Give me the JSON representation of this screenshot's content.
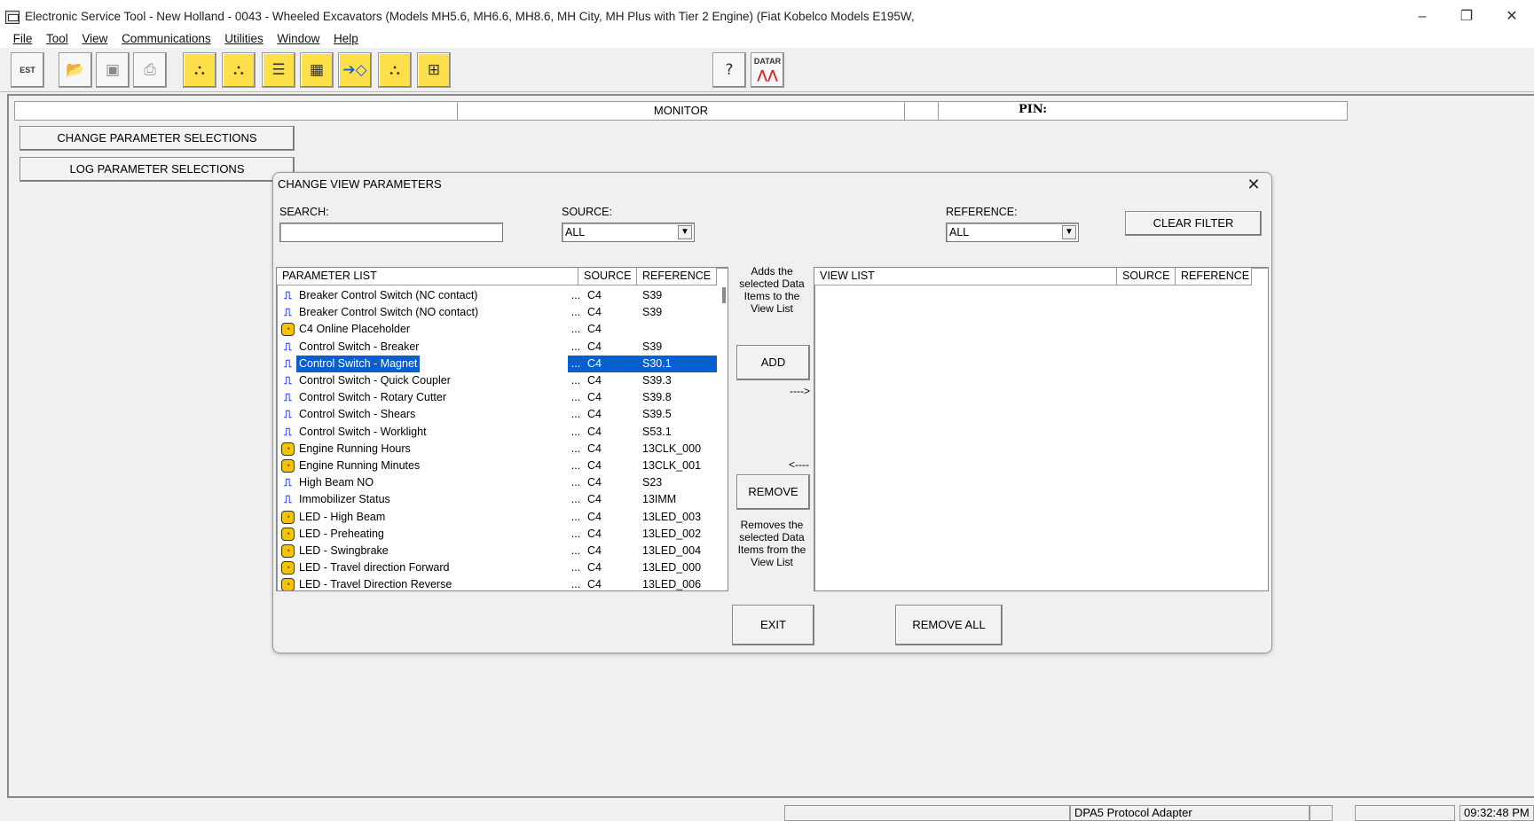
{
  "window": {
    "title": "Electronic Service Tool - New Holland - 0043 - Wheeled Excavators (Models MH5.6, MH6.6, MH8.6, MH City, MH Plus with Tier 2 Engine) (Fiat Kobelco Models E195W,",
    "minimize_glyph": "–",
    "maximize_glyph": "❐",
    "close_glyph": "✕"
  },
  "menu": [
    "File",
    "Tool",
    "View",
    "Communications",
    "Utilities",
    "Window",
    "Help"
  ],
  "toolbar": {
    "est_label": "EST",
    "datar_label": "DATAR"
  },
  "monitor_bar": {
    "monitor_label": "MONITOR",
    "pin_label": "PIN:"
  },
  "side_buttons": {
    "change": "CHANGE PARAMETER SELECTIONS",
    "log": "LOG PARAMETER SELECTIONS"
  },
  "dialog": {
    "title": "CHANGE VIEW PARAMETERS",
    "close_glyph": "✕",
    "search_label": "SEARCH:",
    "search_value": "",
    "source_label": "SOURCE:",
    "source_value": "ALL",
    "reference_label": "REFERENCE:",
    "reference_value": "ALL",
    "clear_filter": "CLEAR FILTER",
    "parameter_list": {
      "headers": [
        "PARAMETER LIST",
        "SOURCE",
        "REFERENCE"
      ],
      "rows": [
        {
          "icon": "signal",
          "name": "Breaker Control Switch (NC contact)",
          "dots": "...",
          "source": "C4",
          "reference": "S39",
          "selected": false
        },
        {
          "icon": "signal",
          "name": "Breaker Control Switch (NO contact)",
          "dots": "...",
          "source": "C4",
          "reference": "S39",
          "selected": false
        },
        {
          "icon": "gauge",
          "name": "C4 Online Placeholder",
          "dots": "...",
          "source": "C4",
          "reference": "",
          "selected": false
        },
        {
          "icon": "signal",
          "name": "Control Switch - Breaker",
          "dots": "...",
          "source": "C4",
          "reference": "S39",
          "selected": false
        },
        {
          "icon": "signal",
          "name": "Control Switch - Magnet",
          "dots": "...",
          "source": "C4",
          "reference": "S30.1",
          "selected": true
        },
        {
          "icon": "signal",
          "name": "Control Switch - Quick Coupler",
          "dots": "...",
          "source": "C4",
          "reference": "S39.3",
          "selected": false
        },
        {
          "icon": "signal",
          "name": "Control Switch - Rotary Cutter",
          "dots": "...",
          "source": "C4",
          "reference": "S39.8",
          "selected": false
        },
        {
          "icon": "signal",
          "name": "Control Switch - Shears",
          "dots": "...",
          "source": "C4",
          "reference": "S39.5",
          "selected": false
        },
        {
          "icon": "signal",
          "name": "Control Switch - Worklight",
          "dots": "...",
          "source": "C4",
          "reference": "S53.1",
          "selected": false
        },
        {
          "icon": "gauge",
          "name": "Engine Running Hours",
          "dots": "...",
          "source": "C4",
          "reference": "13CLK_000",
          "selected": false
        },
        {
          "icon": "gauge",
          "name": "Engine Running Minutes",
          "dots": "...",
          "source": "C4",
          "reference": "13CLK_001",
          "selected": false
        },
        {
          "icon": "signal",
          "name": "High Beam NO",
          "dots": "...",
          "source": "C4",
          "reference": "S23",
          "selected": false
        },
        {
          "icon": "signal",
          "name": "Immobilizer Status",
          "dots": "...",
          "source": "C4",
          "reference": "13IMM",
          "selected": false
        },
        {
          "icon": "gauge",
          "name": "LED - High Beam",
          "dots": "...",
          "source": "C4",
          "reference": "13LED_003",
          "selected": false
        },
        {
          "icon": "gauge",
          "name": "LED - Preheating",
          "dots": "...",
          "source": "C4",
          "reference": "13LED_002",
          "selected": false
        },
        {
          "icon": "gauge",
          "name": "LED - Swingbrake",
          "dots": "...",
          "source": "C4",
          "reference": "13LED_004",
          "selected": false
        },
        {
          "icon": "gauge",
          "name": "LED - Travel direction Forward",
          "dots": "...",
          "source": "C4",
          "reference": "13LED_000",
          "selected": false
        },
        {
          "icon": "gauge",
          "name": "LED - Travel Direction Reverse",
          "dots": "...",
          "source": "C4",
          "reference": "13LED_006",
          "selected": false
        }
      ]
    },
    "add_hint": "Adds the selected Data Items to the View List",
    "add_button": "ADD",
    "add_arrow": "---->",
    "remove_arrow": "<----",
    "remove_button": "REMOVE",
    "remove_hint": "Removes the selected Data Items from the View List",
    "view_list": {
      "headers": [
        "VIEW LIST",
        "SOURCE",
        "REFERENCE"
      ]
    },
    "exit_button": "EXIT",
    "remove_all_button": "REMOVE ALL"
  },
  "statusbar": {
    "adapter": "DPA5 Protocol Adapter",
    "time": "09:32:48 PM"
  },
  "colors": {
    "selection": "#0a5fcf",
    "toolbar_yellow": "#ffe04a",
    "gauge_icon": "#f5c400",
    "signal_icon": "#1a2cff"
  }
}
